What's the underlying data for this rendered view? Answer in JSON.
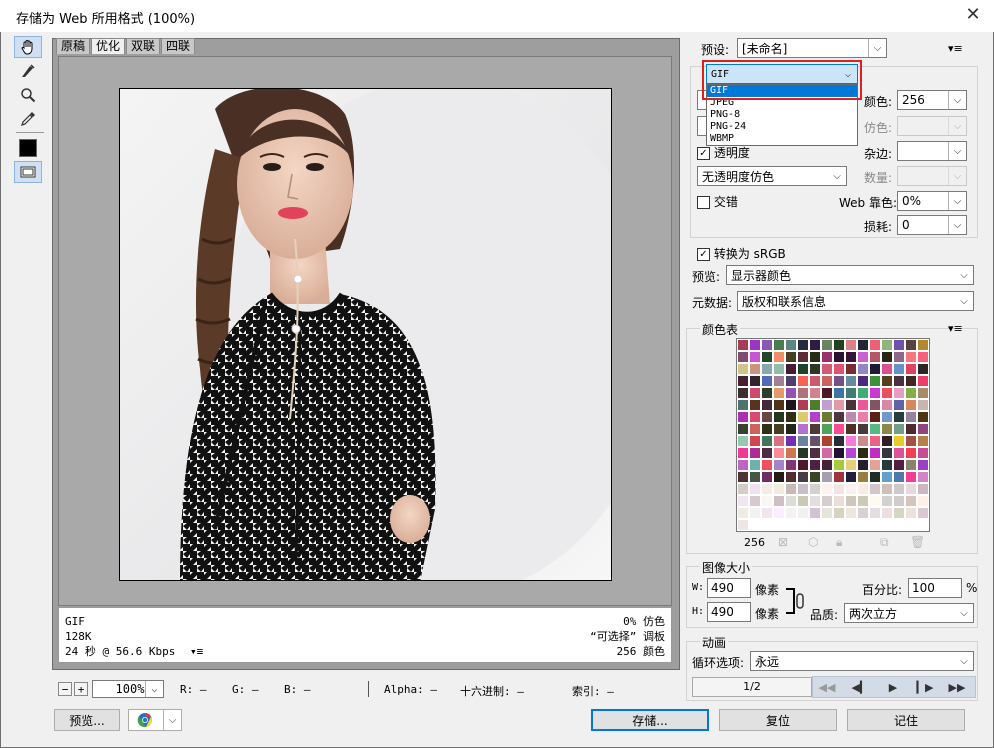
{
  "window": {
    "title": "存储为 Web 所用格式 (100%)",
    "close": "✕"
  },
  "view_tabs": [
    "原稿",
    "优化",
    "双联",
    "四联"
  ],
  "info": {
    "format": "GIF",
    "size": "128K",
    "time": "24 秒 @ 56.6 Kbps",
    "menu": "▾≡",
    "dither": "0% 仿色",
    "palette": "“可选择” 调板",
    "colors": "256 颜色"
  },
  "status": {
    "zoom": "100%",
    "r": "R: —",
    "g": "G: —",
    "b": "B: —",
    "alpha": "Alpha: —",
    "hex": "十六进制: —",
    "index": "索引: —"
  },
  "preset": {
    "label": "预设:",
    "value": "[未命名]",
    "menu": "▾≡"
  },
  "format_dropdown": {
    "selected": "GIF",
    "options": [
      "GIF",
      "JPEG",
      "PNG-8",
      "PNG-24",
      "WBMP"
    ]
  },
  "settings": {
    "colors_label": "颜色:",
    "colors_value": "256",
    "dither_label": "仿色:",
    "transparency_label": "透明度",
    "matte_label": "杂边:",
    "trans_dither_value": "无透明度仿色",
    "amount_label": "数量:",
    "interlace_label": "交错",
    "web_snap_label": "Web 靠色:",
    "web_snap_value": "0%",
    "lossy_label": "损耗:",
    "lossy_value": "0"
  },
  "convert_srgb": "转换为 sRGB",
  "preview": {
    "label": "预览:",
    "value": "显示器颜色"
  },
  "metadata": {
    "label": "元数据:",
    "value": "版权和联系信息"
  },
  "color_table": {
    "title": "颜色表",
    "menu": "▾≡",
    "count": "256"
  },
  "image_size": {
    "title": "图像大小",
    "w_label": "W:",
    "w_value": "490",
    "w_unit": "像素",
    "h_label": "H:",
    "h_value": "490",
    "h_unit": "像素",
    "percent_label": "百分比:",
    "percent_value": "100",
    "percent_unit": "%",
    "quality_label": "品质:",
    "quality_value": "两次立方"
  },
  "animation": {
    "title": "动画",
    "loop_label": "循环选项:",
    "loop_value": "永远",
    "frame": "1/2"
  },
  "buttons": {
    "preview": "预览...",
    "save": "存储...",
    "reset": "复位",
    "remember": "记住"
  },
  "colors": {
    "accent": "#0078d7",
    "highlight": "#e02020"
  }
}
